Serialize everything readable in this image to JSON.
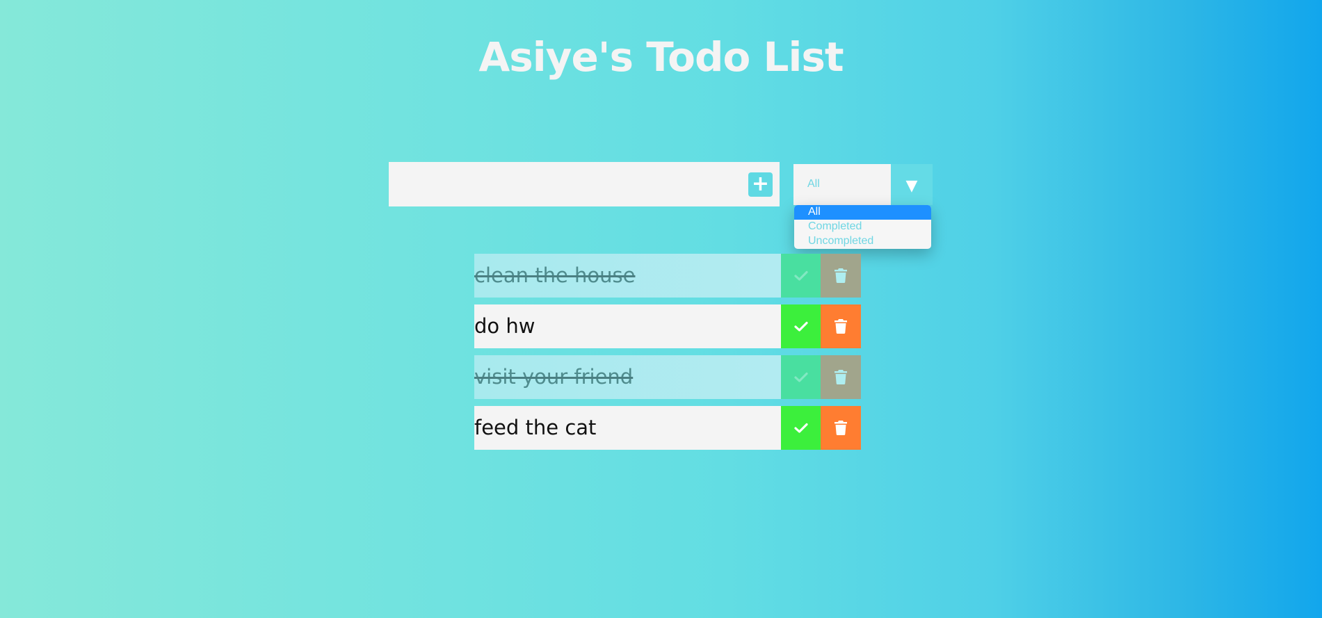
{
  "app": {
    "title": "Asiye's Todo List"
  },
  "add_form": {
    "input_value": "",
    "input_placeholder": "",
    "add_button_label": "+"
  },
  "filter": {
    "selected": "All",
    "arrow": "▼",
    "options": [
      "All",
      "Completed",
      "Uncompleted"
    ]
  },
  "todos": [
    {
      "text": "clean the house",
      "completed": true
    },
    {
      "text": "do hw",
      "completed": false
    },
    {
      "text": "visit your friend",
      "completed": true
    },
    {
      "text": "feed the cat",
      "completed": false
    }
  ],
  "icons": {
    "add": "plus-icon",
    "check": "check-icon",
    "delete": "trash-icon",
    "dropdown": "chevron-down-icon"
  },
  "colors": {
    "check_active": "#3cef3c",
    "trash_active": "#ff7d31",
    "check_done": "#49dfa0",
    "trash_done": "#a1a58c",
    "accent": "#64dbe6",
    "selected_option": "#1e90ff"
  }
}
